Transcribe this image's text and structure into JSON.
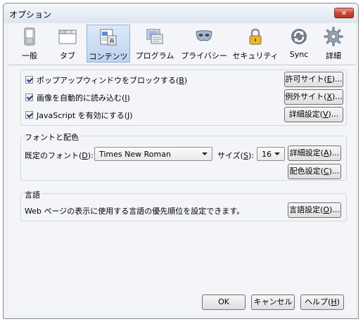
{
  "window": {
    "title": "オプション",
    "close_glyph": "✕"
  },
  "toolbar": {
    "selected": "content",
    "items": [
      {
        "id": "general",
        "label": "一般",
        "icon": "switch-icon"
      },
      {
        "id": "tabs",
        "label": "タブ",
        "icon": "tabs-icon"
      },
      {
        "id": "content",
        "label": "コンテンツ",
        "icon": "content-icon"
      },
      {
        "id": "apps",
        "label": "プログラム",
        "icon": "applications-icon"
      },
      {
        "id": "privacy",
        "label": "プライバシー",
        "icon": "mask-icon"
      },
      {
        "id": "security",
        "label": "セキュリティ",
        "icon": "lock-icon"
      },
      {
        "id": "sync",
        "label": "Sync",
        "icon": "sync-icon"
      },
      {
        "id": "advanced",
        "label": "詳細",
        "icon": "gear-icon"
      }
    ]
  },
  "content": {
    "popup": {
      "label": "ポップアップウィンドウをブロックする(",
      "key": "B",
      "tail": ")",
      "checked": true,
      "button_label": "許可サイト(",
      "button_key": "E",
      "button_tail": ")..."
    },
    "images": {
      "label": "画像を自動的に読み込む(",
      "key": "I",
      "tail": ")",
      "checked": true,
      "button_label": "例外サイト(",
      "button_key": "X",
      "button_tail": ")..."
    },
    "javascript": {
      "label": "JavaScript を有効にする(",
      "key": "J",
      "tail": ")",
      "checked": true,
      "button_label": "詳細設定(",
      "button_key": "V",
      "button_tail": ")..."
    }
  },
  "fonts": {
    "group_title": "フォントと配色",
    "default_font_label": "既定のフォント(",
    "default_font_key": "D",
    "default_font_tail": "):",
    "default_font_value": "Times New Roman",
    "size_label": "サイズ(",
    "size_key": "S",
    "size_tail": "):",
    "size_value": "16",
    "advanced_button": "詳細設定(",
    "advanced_key": "A",
    "advanced_tail": ")...",
    "colors_button": "配色設定(",
    "colors_key": "C",
    "colors_tail": ")..."
  },
  "languages": {
    "group_title": "言語",
    "description": "Web ページの表示に使用する言語の優先順位を設定できます。",
    "button_label": "言語設定(",
    "button_key": "O",
    "button_tail": ")..."
  },
  "footer": {
    "ok": "OK",
    "cancel": "キャンセル",
    "help_label": "ヘルプ(",
    "help_key": "H",
    "help_tail": ")"
  }
}
